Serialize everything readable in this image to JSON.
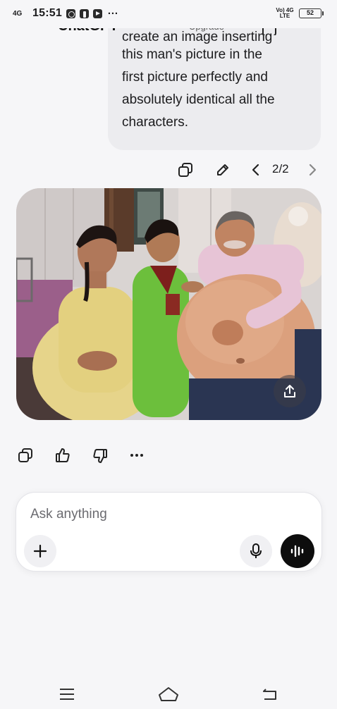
{
  "status_bar": {
    "signal": "4G",
    "time": "15:51",
    "more": "···",
    "network": "Vo) 4G LTE",
    "battery": "52"
  },
  "header": {
    "title": "ChatGPT",
    "upgrade": "Upgrade"
  },
  "message": {
    "clipped_line": "create an image inserting",
    "lines": [
      "this man's picture in the",
      "first picture perfectly and",
      "absolutely identical all the",
      "characters."
    ]
  },
  "message_actions": {
    "pager": "2/2",
    "icons": [
      "copy-icon",
      "edit-icon",
      "chevron-left-icon",
      "chevron-right-icon"
    ]
  },
  "generated_image": {
    "description_icons": [
      "share-icon"
    ]
  },
  "response_actions": {
    "icons": [
      "copy-icon",
      "thumbs-up-icon",
      "thumbs-down-icon",
      "more-icon"
    ]
  },
  "composer": {
    "placeholder": "Ask anything",
    "icons": [
      "plus-icon",
      "mic-icon",
      "voice-mode-icon"
    ]
  },
  "nav_bar": {
    "icons": [
      "menu-icon",
      "home-icon",
      "back-icon"
    ]
  },
  "colors": {
    "background": "#f6f6f8",
    "bubble": "#ececef",
    "voice_button": "#0d0d0d"
  }
}
